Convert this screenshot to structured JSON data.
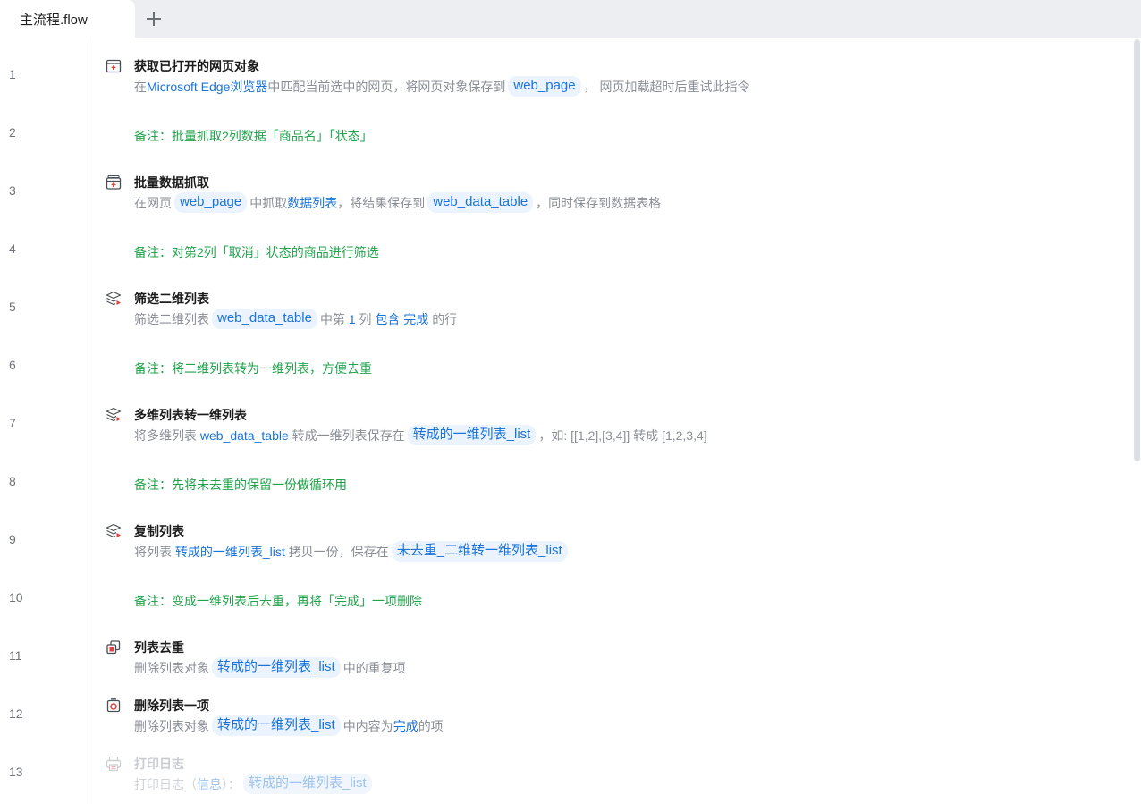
{
  "tabs": [
    {
      "label": "主流程.flow",
      "active": true
    }
  ],
  "line_numbers": [
    "1",
    "2",
    "3",
    "4",
    "5",
    "6",
    "7",
    "8",
    "9",
    "10",
    "11",
    "12",
    "13"
  ],
  "steps": {
    "s1": {
      "icon": "web-page-icon",
      "title": "获取已打开的网页对象",
      "desc": [
        "在",
        "Microsoft Edge浏览器",
        "中匹配当前选中的网页，将网页对象保存到",
        "web_page",
        "， 网页加载超时后重试此指令"
      ]
    },
    "s3": {
      "icon": "data-scrape-icon",
      "title": "批量数据抓取",
      "desc": [
        "在网页",
        "web_page",
        "中抓取",
        "数据列表",
        "，将结果保存到",
        "web_data_table",
        "，同时保存到数据表格"
      ]
    },
    "s5": {
      "icon": "stack-filter-icon",
      "title": "筛选二维列表",
      "desc": [
        "筛选二维列表",
        "web_data_table",
        "中第",
        "1",
        "列",
        "包含",
        "完成",
        "的行"
      ]
    },
    "s7": {
      "icon": "stack-convert-icon",
      "title": "多维列表转一维列表",
      "desc": [
        "将多维列表",
        "web_data_table",
        "转成一维列表保存在",
        "转成的一维列表_list",
        "，如: [[1,2],[3,4]] 转成 [1,2,3,4]"
      ]
    },
    "s9": {
      "icon": "stack-copy-icon",
      "title": "复制列表",
      "desc": [
        "将列表",
        "转成的一维列表_list",
        "拷贝一份，保存在",
        "未去重_二维转一维列表_list"
      ]
    },
    "s11": {
      "icon": "dedupe-icon",
      "title": "列表去重",
      "desc": [
        "删除列表对象",
        "转成的一维列表_list",
        "中的重复项"
      ]
    },
    "s12": {
      "icon": "delete-item-icon",
      "title": "删除列表一项",
      "desc": [
        "删除列表对象",
        "转成的一维列表_list",
        "中内容为",
        "完成",
        "的项"
      ]
    },
    "s13": {
      "icon": "print-log-icon",
      "title": "打印日志",
      "disabled": true,
      "desc": [
        "打印日志（",
        "信息",
        "）：",
        "转成的一维列表_list"
      ]
    }
  },
  "comments": {
    "c2": "备注：批量抓取2列数据「商品名」「状态」",
    "c4": "备注：对第2列「取消」状态的商品进行筛选",
    "c6": "备注：将二维列表转为一维列表，方便去重",
    "c8": "备注：先将未去重的保留一份做循环用",
    "c10": "备注：变成一维列表后去重，再将「完成」一项删除"
  },
  "colors": {
    "accent": "#1a73d9",
    "comment": "#1fa34a",
    "icon_red": "#e0433b"
  }
}
